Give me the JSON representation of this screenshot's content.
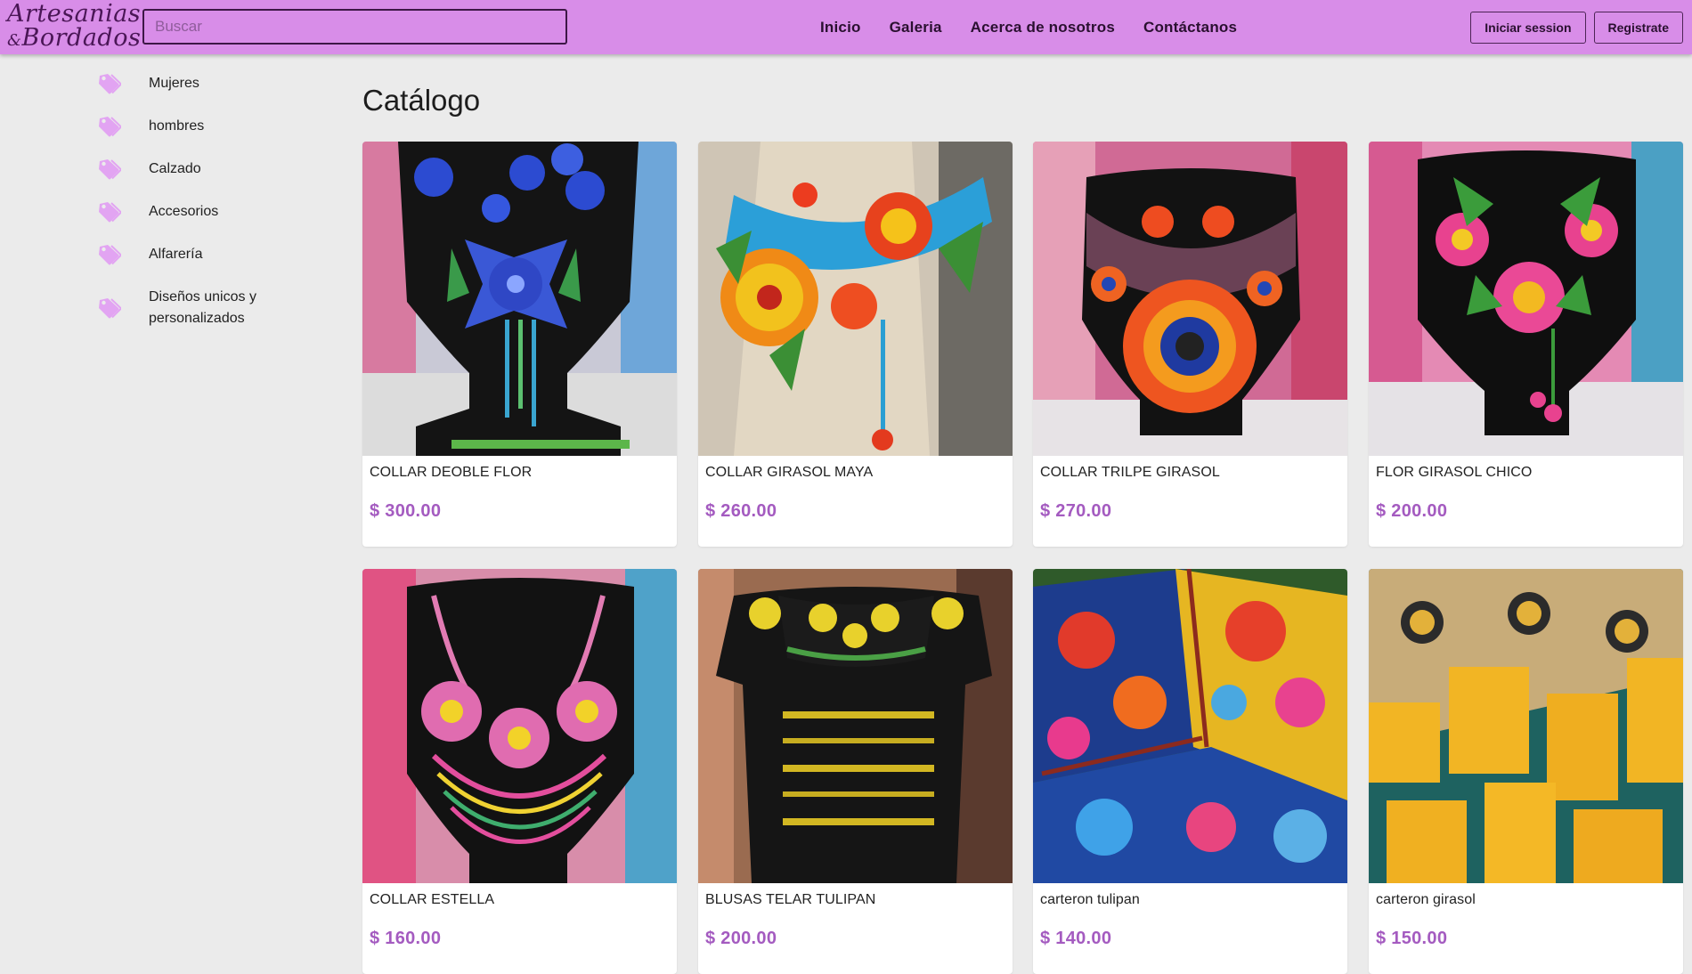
{
  "header": {
    "logo_line1": "Artesanias",
    "logo_amp": "&",
    "logo_line2": "Bordados",
    "search_placeholder": "Buscar",
    "nav": [
      "Inicio",
      "Galeria",
      "Acerca de nosotros",
      "Contáctanos"
    ],
    "login_label": "Iniciar session",
    "register_label": "Registrate"
  },
  "sidebar": {
    "icon": "tag-icon",
    "items": [
      {
        "label": "Mujeres"
      },
      {
        "label": "hombres"
      },
      {
        "label": "Calzado"
      },
      {
        "label": "Accesorios"
      },
      {
        "label": "Alfarería"
      },
      {
        "label": "Diseños unicos y personalizados"
      }
    ]
  },
  "catalog": {
    "title": "Catálogo",
    "products": [
      {
        "name": "COLLAR DEOBLE FLOR",
        "price": "$ 300.00"
      },
      {
        "name": "COLLAR GIRASOL MAYA",
        "price": "$ 260.00"
      },
      {
        "name": "COLLAR TRILPE GIRASOL",
        "price": "$ 270.00"
      },
      {
        "name": "FLOR GIRASOL CHICO",
        "price": "$ 200.00"
      },
      {
        "name": "COLLAR ESTELLA",
        "price": "$ 160.00"
      },
      {
        "name": "BLUSAS TELAR TULIPAN",
        "price": "$ 200.00"
      },
      {
        "name": "carteron tulipan",
        "price": "$ 140.00"
      },
      {
        "name": "carteron girasol",
        "price": "$ 150.00"
      }
    ]
  },
  "colors": {
    "header_bg": "#d88de8",
    "page_bg": "#ebebeb",
    "tag_icon": "#e2a4f2",
    "price": "#a45bc0"
  }
}
